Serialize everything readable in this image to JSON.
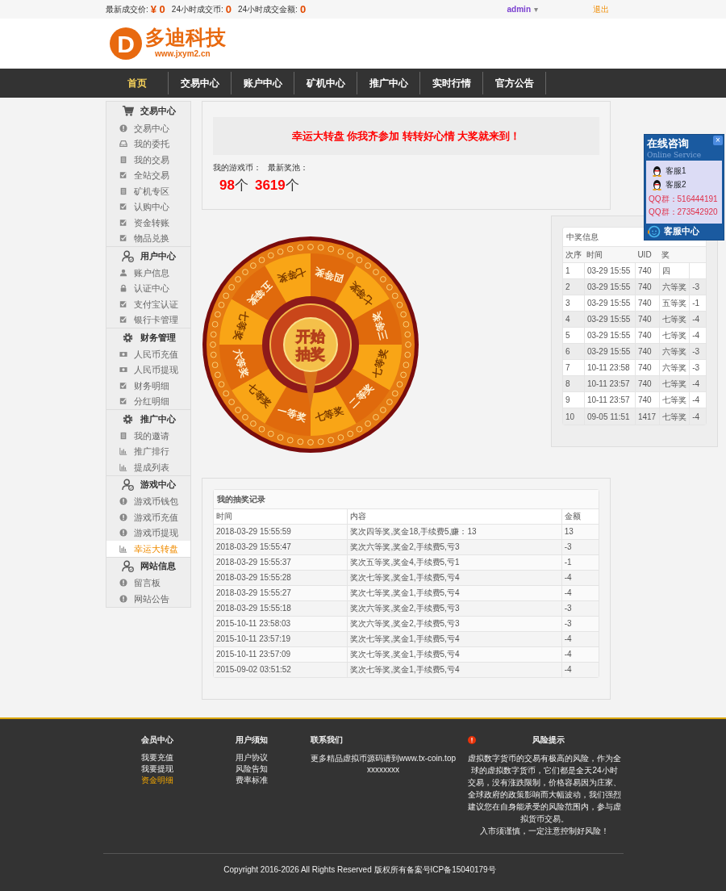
{
  "top_bar": {
    "stats": [
      {
        "label": "最新成交价:",
        "value": "¥ 0"
      },
      {
        "label": "24小时成交币:",
        "value": "0"
      },
      {
        "label": "24小时成交金额:",
        "value": "0"
      }
    ],
    "user": "admin",
    "caret": "▾",
    "logout": "退出"
  },
  "logo": {
    "name": "多迪科技",
    "letter": "D",
    "url": "www.jxym2.cn"
  },
  "nav": [
    {
      "label": "首页",
      "selected": true
    },
    {
      "label": "交易中心",
      "selected": false
    },
    {
      "label": "账户中心",
      "selected": false
    },
    {
      "label": "矿机中心",
      "selected": false
    },
    {
      "label": "推广中心",
      "selected": false
    },
    {
      "label": "实时行情",
      "selected": false
    },
    {
      "label": "官方公告",
      "selected": false
    }
  ],
  "sidebar": [
    {
      "title": "交易中心",
      "kind": "cart",
      "items": [
        {
          "label": "交易中心",
          "kind": "info",
          "selected": false
        },
        {
          "label": "我的委托",
          "kind": "inbox",
          "selected": false
        },
        {
          "label": "我的交易",
          "kind": "list",
          "selected": false
        },
        {
          "label": "全站交易",
          "kind": "check",
          "selected": false
        },
        {
          "label": "矿机专区",
          "kind": "list",
          "selected": false
        },
        {
          "label": "认购中心",
          "kind": "check",
          "selected": false
        },
        {
          "label": "资金转账",
          "kind": "check",
          "selected": false
        },
        {
          "label": "物品兑换",
          "kind": "check",
          "selected": false
        }
      ]
    },
    {
      "title": "用户中心",
      "kind": "user",
      "items": [
        {
          "label": "账户信息",
          "kind": "person",
          "selected": false
        },
        {
          "label": "认证中心",
          "kind": "lock",
          "selected": false
        },
        {
          "label": "支付宝认证",
          "kind": "check",
          "selected": false
        },
        {
          "label": "银行卡管理",
          "kind": "check",
          "selected": false
        }
      ]
    },
    {
      "title": "财务管理",
      "kind": "gear",
      "items": [
        {
          "label": "人民币充值",
          "kind": "money",
          "selected": false
        },
        {
          "label": "人民币提现",
          "kind": "money",
          "selected": false
        },
        {
          "label": "财务明细",
          "kind": "check",
          "selected": false
        },
        {
          "label": "分红明细",
          "kind": "check",
          "selected": false
        }
      ]
    },
    {
      "title": "推广中心",
      "kind": "gear",
      "items": [
        {
          "label": "我的邀请",
          "kind": "list",
          "selected": false
        },
        {
          "label": "推广排行",
          "kind": "chart",
          "selected": false
        },
        {
          "label": "提成列表",
          "kind": "chart",
          "selected": false
        }
      ]
    },
    {
      "title": "游戏中心",
      "kind": "user",
      "items": [
        {
          "label": "游戏币钱包",
          "kind": "info",
          "selected": false
        },
        {
          "label": "游戏币充值",
          "kind": "info",
          "selected": false
        },
        {
          "label": "游戏币提现",
          "kind": "info",
          "selected": false
        },
        {
          "label": "幸运大转盘",
          "kind": "chart",
          "selected": true
        }
      ]
    },
    {
      "title": "网站信息",
      "kind": "user",
      "items": [
        {
          "label": "留言板",
          "kind": "info",
          "selected": false
        },
        {
          "label": "网站公告",
          "kind": "info",
          "selected": false
        }
      ]
    }
  ],
  "banner": "幸运大转盘 你我齐参加 转转好心情 大奖就来到！",
  "balances": {
    "labels": [
      "我的游戏币：",
      "最新奖池："
    ],
    "values": [
      {
        "value": "98",
        "unit": "个"
      },
      {
        "value": "3619",
        "unit": "个"
      }
    ]
  },
  "wheel": {
    "segments": [
      "四等奖",
      "七等奖",
      "三等奖",
      "七等奖",
      "二等奖",
      "七等奖",
      "一等奖",
      "七等奖",
      "六等奖",
      "七等奖",
      "五等奖",
      "七等奖"
    ],
    "button": [
      "开始",
      "抽奖"
    ]
  },
  "winners": {
    "title": "中奖信息",
    "columns": [
      "次序",
      "时间",
      "UID",
      "奖"
    ],
    "rows": [
      [
        "1",
        "03-29 15:55",
        "740",
        "四"
      ],
      [
        "2",
        "03-29 15:55",
        "740",
        "六等奖",
        "-3"
      ],
      [
        "3",
        "03-29 15:55",
        "740",
        "五等奖",
        "-1"
      ],
      [
        "4",
        "03-29 15:55",
        "740",
        "七等奖",
        "-4"
      ],
      [
        "5",
        "03-29 15:55",
        "740",
        "七等奖",
        "-4"
      ],
      [
        "6",
        "03-29 15:55",
        "740",
        "六等奖",
        "-3"
      ],
      [
        "7",
        "10-11 23:58",
        "740",
        "六等奖",
        "-3"
      ],
      [
        "8",
        "10-11 23:57",
        "740",
        "七等奖",
        "-4"
      ],
      [
        "9",
        "10-11 23:57",
        "740",
        "七等奖",
        "-4"
      ],
      [
        "10",
        "09-05 11:51",
        "1417",
        "七等奖",
        "-4"
      ]
    ]
  },
  "records": {
    "title": "我的抽奖记录",
    "columns": [
      "时间",
      "内容",
      "金额"
    ],
    "rows": [
      [
        "2018-03-29 15:55:59",
        "奖次四等奖,奖金18,手续费5,赚：13",
        "13"
      ],
      [
        "2018-03-29 15:55:47",
        "奖次六等奖,奖金2,手续费5,亏3",
        "-3"
      ],
      [
        "2018-03-29 15:55:37",
        "奖次五等奖,奖金4,手续费5,亏1",
        "-1"
      ],
      [
        "2018-03-29 15:55:28",
        "奖次七等奖,奖金1,手续费5,亏4",
        "-4"
      ],
      [
        "2018-03-29 15:55:27",
        "奖次七等奖,奖金1,手续费5,亏4",
        "-4"
      ],
      [
        "2018-03-29 15:55:18",
        "奖次六等奖,奖金2,手续费5,亏3",
        "-3"
      ],
      [
        "2015-10-11 23:58:03",
        "奖次六等奖,奖金2,手续费5,亏3",
        "-3"
      ],
      [
        "2015-10-11 23:57:19",
        "奖次七等奖,奖金1,手续费5,亏4",
        "-4"
      ],
      [
        "2015-10-11 23:57:09",
        "奖次七等奖,奖金1,手续费5,亏4",
        "-4"
      ],
      [
        "2015-09-02 03:51:52",
        "奖次七等奖,奖金1,手续费5,亏4",
        "-4"
      ]
    ]
  },
  "online_service": {
    "title": "在线咨询",
    "subtitle": "Online Service",
    "close": "×",
    "agents": [
      "客服1",
      "客服2"
    ],
    "groups": [
      "QQ群：516444191",
      "QQ群：273542920"
    ],
    "footer": "客服中心"
  },
  "footer": {
    "columns": [
      {
        "title": "会员中心",
        "kind": "links",
        "links": [
          {
            "label": "我要充值",
            "selected": false
          },
          {
            "label": "我要提现",
            "selected": false
          },
          {
            "label": "资金明细",
            "selected": true
          }
        ]
      },
      {
        "title": "用户须知",
        "kind": "links",
        "links": [
          {
            "label": "用户协议",
            "selected": false
          },
          {
            "label": "风险告知",
            "selected": false
          },
          {
            "label": "费率标准",
            "selected": false
          }
        ]
      },
      {
        "title": "联系我们",
        "kind": "text",
        "lines": [
          "更多精品虚拟币源码请到www.tx-coin.top",
          "xxxxxxxx"
        ]
      },
      {
        "title": "风险提示",
        "kind": "warning",
        "lines": [
          "虚拟数字货币的交易有极高的风险，作为全球的虚拟数字货币，它们都是全天24小时交易，没有涨跌限制，价格容易因为庄家、全球政府的政策影响而大幅波动，我们强烈建议您在自身能承受的风险范围内，参与虚拟货币交易。",
          "入市须谨慎，一定注意控制好风险！"
        ]
      }
    ],
    "copyright": "Copyright 2016-2026 All Rights Reserved 版权所有备案号ICP备15040179号"
  }
}
